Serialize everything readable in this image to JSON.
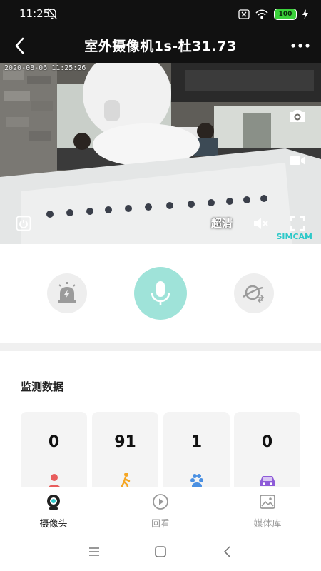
{
  "status_bar": {
    "time": "11:25",
    "battery": "100",
    "icons": [
      "bell-off-icon",
      "sim-disabled-icon",
      "wifi-icon",
      "battery-icon",
      "charging-icon"
    ]
  },
  "header": {
    "title": "室外摄像机1s-杜31.73",
    "icons": [
      "back-arrow-icon",
      "more-dots-icon"
    ]
  },
  "video": {
    "timestamp": "2020-08-06 11:25:26",
    "quality_label": "超清",
    "watermark": "SIMCAM",
    "icons": [
      "snapshot-camera-icon",
      "record-video-icon",
      "power-icon",
      "mute-speaker-icon",
      "fullscreen-icon"
    ]
  },
  "controls": {
    "accent_color": "#9fe3d9",
    "icons": [
      "alarm-light-icon",
      "microphone-icon",
      "planet-switch-icon"
    ]
  },
  "monitor": {
    "title": "监测数据",
    "stats": [
      {
        "value": "0",
        "icon": "person-icon",
        "color": "#e85d5d"
      },
      {
        "value": "91",
        "icon": "walking-person-icon",
        "color": "#f5a623"
      },
      {
        "value": "1",
        "icon": "pet-paw-icon",
        "color": "#4a90e2"
      },
      {
        "value": "0",
        "icon": "vehicle-icon",
        "color": "#8e5bd8"
      }
    ]
  },
  "tabs": [
    {
      "label": "摄像头",
      "icon": "camera-icon",
      "active": true
    },
    {
      "label": "回看",
      "icon": "play-circle-icon",
      "active": false
    },
    {
      "label": "媒体库",
      "icon": "image-gallery-icon",
      "active": false
    }
  ],
  "nav": {
    "icons": [
      "menu-lines-icon",
      "home-square-icon",
      "back-chevron-icon"
    ]
  }
}
